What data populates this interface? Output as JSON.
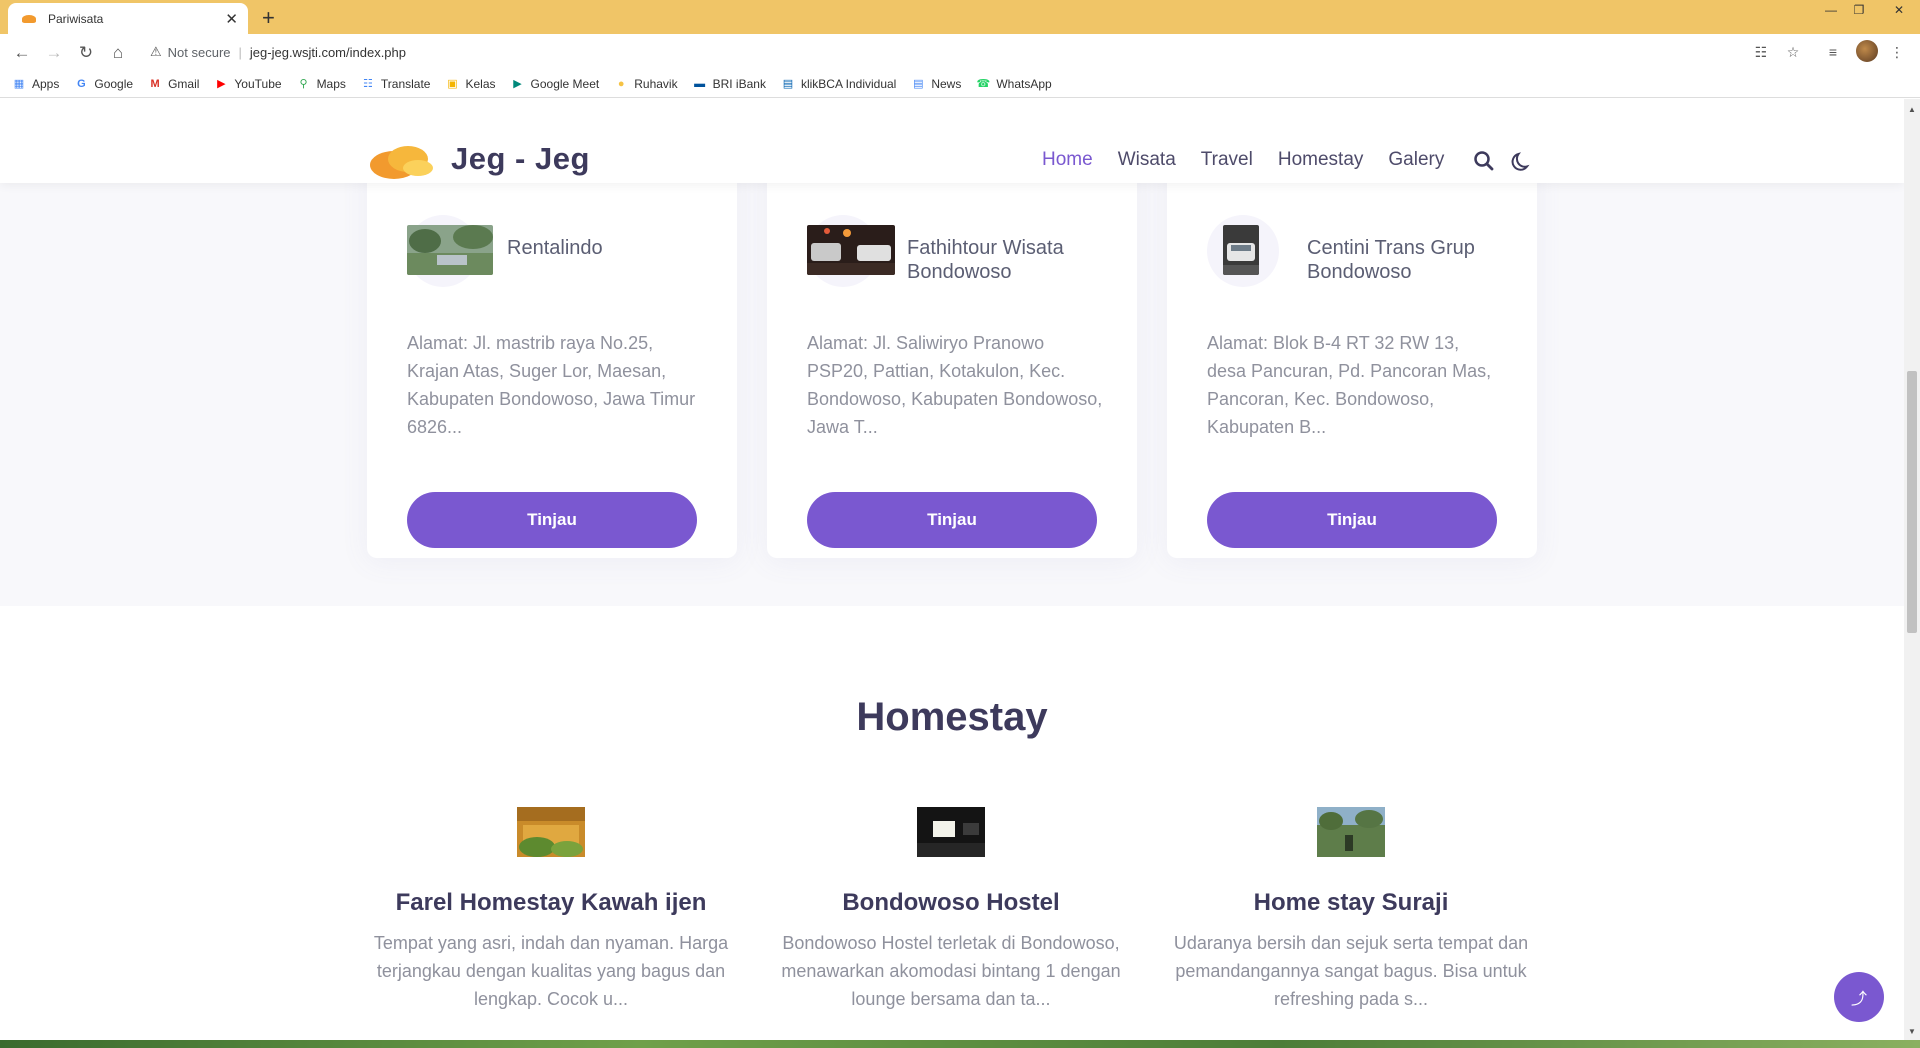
{
  "browser": {
    "tab_title": "Pariwisata",
    "tab_close": "✕",
    "new_tab": "+",
    "security_label": "Not secure",
    "url": "jeg-jeg.wsjti.com/index.php",
    "bookmarks": [
      {
        "label": "Apps",
        "icon": "apps-grid-icon",
        "color": "#4285f4"
      },
      {
        "label": "Google",
        "icon": "google-icon",
        "color": "#4285f4"
      },
      {
        "label": "Gmail",
        "icon": "gmail-icon",
        "color": "#d93025"
      },
      {
        "label": "YouTube",
        "icon": "youtube-icon",
        "color": "#ff0000"
      },
      {
        "label": "Maps",
        "icon": "maps-icon",
        "color": "#34a853"
      },
      {
        "label": "Translate",
        "icon": "translate-icon",
        "color": "#4285f4"
      },
      {
        "label": "Kelas",
        "icon": "kelas-icon",
        "color": "#f4b400"
      },
      {
        "label": "Google Meet",
        "icon": "meet-icon",
        "color": "#00897b"
      },
      {
        "label": "Ruhavik",
        "icon": "ruhavik-icon",
        "color": "#f6c344"
      },
      {
        "label": "BRI iBank",
        "icon": "bri-icon",
        "color": "#00529c"
      },
      {
        "label": "klikBCA Individual",
        "icon": "bca-icon",
        "color": "#0060af"
      },
      {
        "label": "News",
        "icon": "news-icon",
        "color": "#4285f4"
      },
      {
        "label": "WhatsApp",
        "icon": "whatsapp-icon",
        "color": "#25d366"
      }
    ]
  },
  "site": {
    "brand": "Jeg - Jeg",
    "nav": [
      {
        "label": "Home",
        "active": true
      },
      {
        "label": "Wisata",
        "active": false
      },
      {
        "label": "Travel",
        "active": false
      },
      {
        "label": "Homestay",
        "active": false
      },
      {
        "label": "Galery",
        "active": false
      }
    ],
    "accent_color": "#7a58d0"
  },
  "travel_cards": [
    {
      "name": "Rentalindo",
      "address": "Alamat:    Jl. mastrib raya No.25, Krajan Atas, Suger Lor, Maesan, Kabupaten Bondowoso, Jawa Timur 6826...",
      "button": "Tinjau"
    },
    {
      "name": "Fathihtour Wisata Bondowoso",
      "address": "Alamat:    Jl. Saliwiryo Pranowo PSP20, Pattian, Kotakulon, Kec. Bondowoso, Kabupaten Bondowoso, Jawa T...",
      "button": "Tinjau"
    },
    {
      "name": "Centini Trans Grup Bondowoso",
      "address": "Alamat:    Blok B-4 RT 32 RW 13, desa Pancuran, Pd. Pancoran Mas, Pancoran, Kec. Bondowoso, Kabupaten B...",
      "button": "Tinjau"
    }
  ],
  "homestay": {
    "title": "Homestay",
    "items": [
      {
        "name": "Farel Homestay Kawah ijen",
        "desc": "Tempat yang asri, indah dan nyaman. Harga terjangkau dengan kualitas yang bagus dan lengkap. Cocok u..."
      },
      {
        "name": "Bondowoso Hostel",
        "desc": "Bondowoso Hostel terletak di Bondowoso, menawarkan akomodasi bintang 1 dengan lounge bersama dan ta..."
      },
      {
        "name": "Home stay Suraji",
        "desc": "Udaranya bersih dan sejuk serta tempat dan pemandangannya sangat bagus. Bisa untuk refreshing pada s..."
      }
    ]
  }
}
